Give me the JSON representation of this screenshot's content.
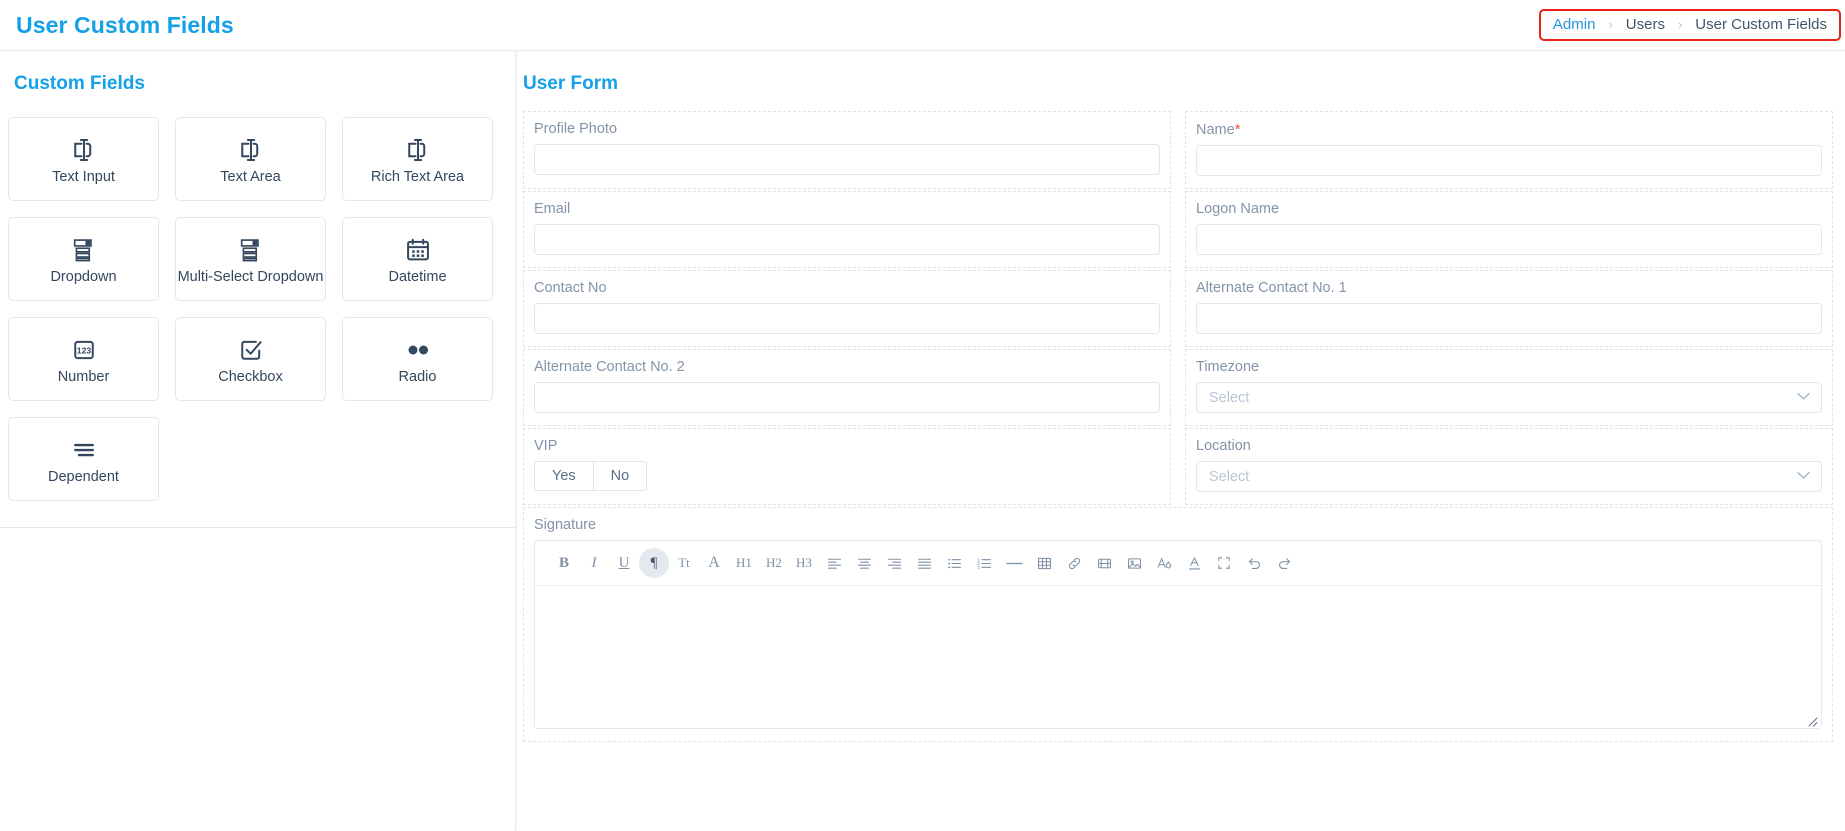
{
  "header": {
    "title": "User Custom Fields",
    "breadcrumb": [
      {
        "label": "Admin",
        "link": true
      },
      {
        "label": "Users",
        "link": false
      },
      {
        "label": "User Custom Fields",
        "link": false
      }
    ],
    "separator": "›",
    "highlight_color": "#e8221a",
    "accent_color": "#14a1e8"
  },
  "left_panel": {
    "title": "Custom Fields",
    "cards": [
      {
        "label": "Text Input",
        "icon": "text-input-icon"
      },
      {
        "label": "Text Area",
        "icon": "text-area-icon"
      },
      {
        "label": "Rich Text Area",
        "icon": "rich-text-area-icon"
      },
      {
        "label": "Dropdown",
        "icon": "dropdown-icon"
      },
      {
        "label": "Multi-Select Dropdown",
        "icon": "multi-select-dropdown-icon"
      },
      {
        "label": "Datetime",
        "icon": "calendar-icon"
      },
      {
        "label": "Number",
        "icon": "number-123-icon"
      },
      {
        "label": "Checkbox",
        "icon": "checkbox-icon"
      },
      {
        "label": "Radio",
        "icon": "radio-icon"
      },
      {
        "label": "Dependent",
        "icon": "dependent-lines-icon"
      }
    ]
  },
  "form": {
    "title": "User Form",
    "fields": [
      {
        "label": "Profile Photo",
        "type": "text",
        "value": "",
        "required": false
      },
      {
        "label": "Name",
        "type": "text",
        "value": "",
        "required": true
      },
      {
        "label": "Email",
        "type": "text",
        "value": "",
        "required": false
      },
      {
        "label": "Logon Name",
        "type": "text",
        "value": "",
        "required": false
      },
      {
        "label": "Contact No",
        "type": "text",
        "value": "",
        "required": false
      },
      {
        "label": "Alternate Contact No. 1",
        "type": "text",
        "value": "",
        "required": false
      },
      {
        "label": "Alternate Contact No. 2",
        "type": "text",
        "value": "",
        "required": false
      },
      {
        "label": "Timezone",
        "type": "select",
        "placeholder": "Select",
        "required": false
      },
      {
        "label": "VIP",
        "type": "segmented",
        "options": [
          "Yes",
          "No"
        ],
        "required": false
      },
      {
        "label": "Location",
        "type": "select",
        "placeholder": "Select",
        "required": false
      }
    ],
    "signature": {
      "label": "Signature",
      "content": "",
      "toolbar": [
        {
          "name": "bold-icon",
          "glyph": "B",
          "active": false
        },
        {
          "name": "italic-icon",
          "glyph": "I",
          "active": false
        },
        {
          "name": "underline-icon",
          "glyph": "U",
          "active": false
        },
        {
          "name": "paragraph-icon",
          "glyph": "¶",
          "active": true
        },
        {
          "name": "font-size-icon",
          "glyph": "Tt",
          "active": false
        },
        {
          "name": "font-family-icon",
          "glyph": "A",
          "active": false
        },
        {
          "name": "heading-1-icon",
          "glyph": "H1",
          "active": false
        },
        {
          "name": "heading-2-icon",
          "glyph": "H2",
          "active": false
        },
        {
          "name": "heading-3-icon",
          "glyph": "H3",
          "active": false
        },
        {
          "name": "align-left-icon",
          "glyph": "",
          "active": false
        },
        {
          "name": "align-center-icon",
          "glyph": "",
          "active": false
        },
        {
          "name": "align-right-icon",
          "glyph": "",
          "active": false
        },
        {
          "name": "align-justify-icon",
          "glyph": "",
          "active": false
        },
        {
          "name": "bullet-list-icon",
          "glyph": "",
          "active": false
        },
        {
          "name": "numbered-list-icon",
          "glyph": "",
          "active": false
        },
        {
          "name": "horizontal-rule-icon",
          "glyph": "",
          "active": false
        },
        {
          "name": "table-icon",
          "glyph": "",
          "active": false
        },
        {
          "name": "link-icon",
          "glyph": "",
          "active": false
        },
        {
          "name": "video-icon",
          "glyph": "",
          "active": false
        },
        {
          "name": "image-icon",
          "glyph": "",
          "active": false
        },
        {
          "name": "text-color-icon",
          "glyph": "",
          "active": false
        },
        {
          "name": "text-highlight-icon",
          "glyph": "",
          "active": false
        },
        {
          "name": "fullscreen-icon",
          "glyph": "",
          "active": false
        },
        {
          "name": "undo-icon",
          "glyph": "",
          "active": false
        },
        {
          "name": "redo-icon",
          "glyph": "",
          "active": false
        }
      ]
    }
  }
}
